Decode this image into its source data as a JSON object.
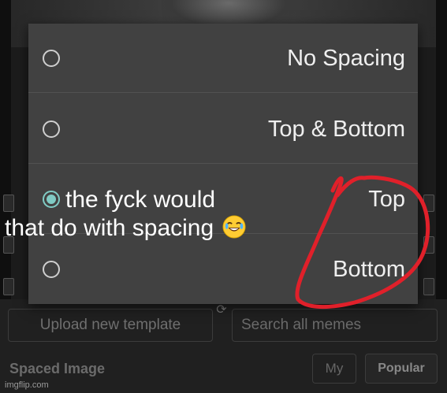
{
  "dialog": {
    "options": [
      {
        "label": "No Spacing",
        "checked": false
      },
      {
        "label": "Top & Bottom",
        "checked": false
      },
      {
        "label": "Top",
        "checked": true
      },
      {
        "label": "Bottom",
        "checked": false
      }
    ]
  },
  "caption": {
    "line1": "the fyck would",
    "line2": "that do with spacing",
    "emoji": "face-with-tears-of-joy"
  },
  "toolbar": {
    "upload_label": "Upload new template",
    "search_placeholder": "Search all memes"
  },
  "templates": {
    "title": "Spaced Image",
    "tab_my": "My",
    "tab_popular": "Popular"
  },
  "watermark": "imgflip.com",
  "colors": {
    "accent_radio": "#80cbc4",
    "annotation_red": "#e0202a",
    "dialog_bg": "#414141"
  }
}
